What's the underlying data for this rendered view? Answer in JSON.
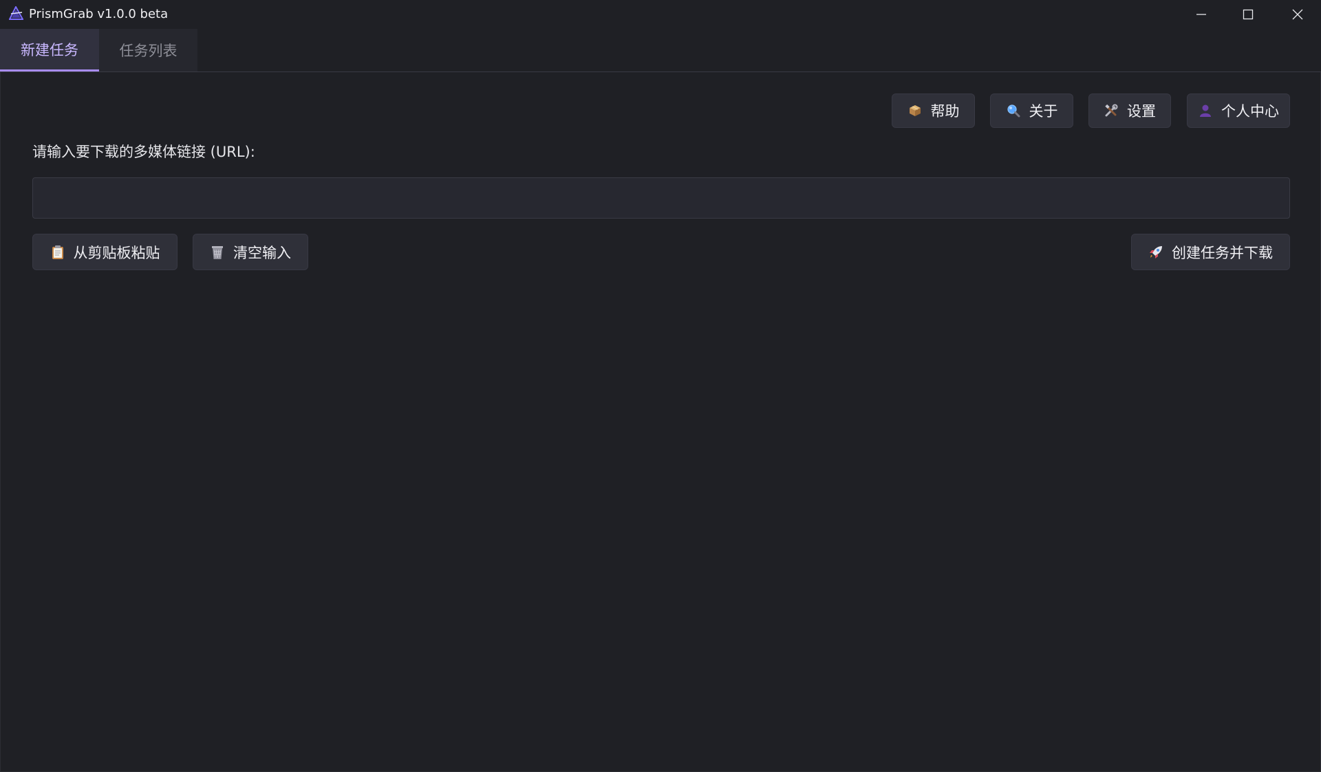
{
  "window": {
    "title": "PrismGrab v1.0.0 beta",
    "logo_icon": "prism-logo-icon",
    "controls": {
      "minimize_icon": "minimize-icon",
      "maximize_icon": "maximize-icon",
      "close_icon": "close-icon"
    }
  },
  "tabs": [
    {
      "label": "新建任务",
      "active": true
    },
    {
      "label": "任务列表",
      "active": false
    }
  ],
  "toolbar": {
    "help": {
      "label": "帮助",
      "icon": "package-icon"
    },
    "about": {
      "label": "关于",
      "icon": "magnifier-icon"
    },
    "settings": {
      "label": "设置",
      "icon": "tools-icon"
    },
    "profile": {
      "label": "个人中心",
      "icon": "user-icon"
    }
  },
  "form": {
    "url_label": "请输入要下载的多媒体链接 (URL):",
    "url_value": "",
    "url_placeholder": ""
  },
  "actions": {
    "paste": {
      "label": "从剪贴板粘贴",
      "icon": "clipboard-icon"
    },
    "clear": {
      "label": "清空输入",
      "icon": "wastebasket-icon"
    },
    "create": {
      "label": "创建任务并下载",
      "icon": "rocket-icon"
    }
  },
  "colors": {
    "background": "#1f2025",
    "button": "#2f3039",
    "accent": "#a98cf2",
    "active_tab_text": "#c9b8ff",
    "inactive_tab_text": "#8d8e97"
  }
}
